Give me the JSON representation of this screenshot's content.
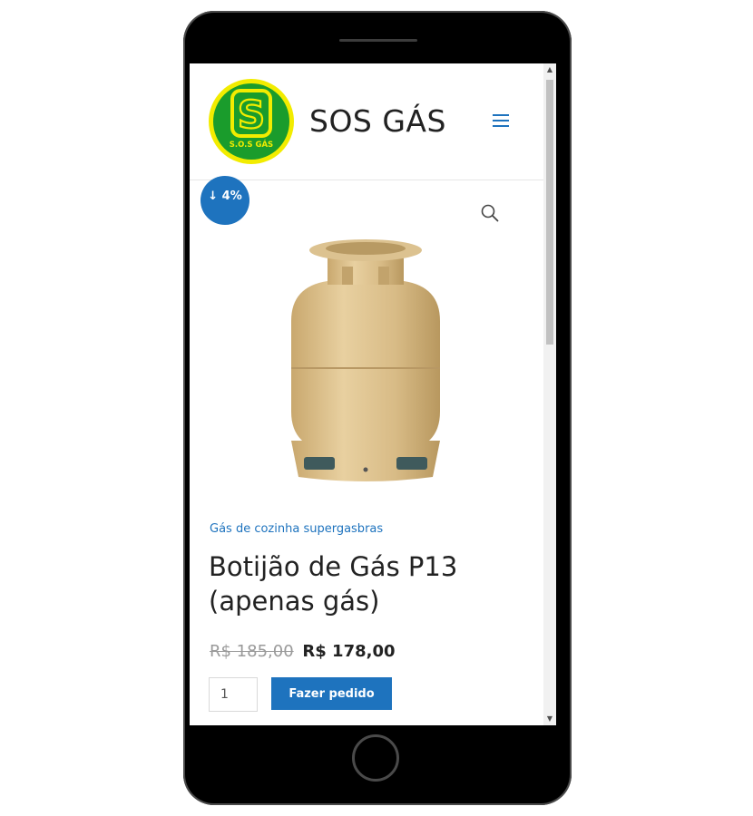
{
  "site": {
    "title": "SOS GÁS",
    "logo_text": "S.O.S GÁS",
    "logo_monogram": "S"
  },
  "product": {
    "sale_badge": "↓ 4%",
    "category": "Gás de cozinha supergasbras",
    "title": "Botijão de Gás P13 (apenas gás)",
    "price_old": "R$ 185,00",
    "price_new": "R$ 178,00",
    "quantity": "1",
    "order_button_label": "Fazer pedido"
  },
  "icons": {
    "menu": "hamburger-menu-icon",
    "search": "search-icon",
    "scroll_up": "▲",
    "scroll_down": "▼"
  },
  "colors": {
    "accent": "#1e73be",
    "logo_green": "#1a9c2c",
    "logo_yellow": "#f2ec00",
    "cylinder": "#d9bd8a"
  }
}
